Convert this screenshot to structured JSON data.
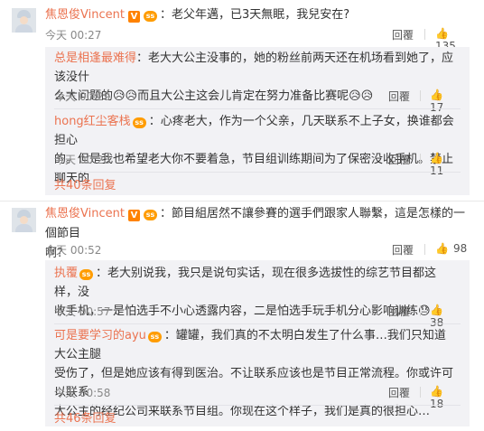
{
  "threads": [
    {
      "user": "焦恩俊Vincent",
      "v_badge": "V",
      "level_badge": "ss",
      "text": "：老父年邁，已3天無眠，我兒安在?",
      "time": "今天 00:27",
      "reply_label": "回覆",
      "likes": "135",
      "replies": [
        {
          "user": "总是相逢最难得",
          "lines": [
            "：老大大公主没事的，她的粉丝前两天还在机场看到她了，应该没什",
            "么大问题的😥😥而且大公主这会儿肯定在努力准备比赛呢😥😥"
          ],
          "time": "今天 00:29",
          "reply_label": "回覆",
          "likes": "17"
        },
        {
          "user": "hong红尘客栈",
          "level_badge": "ss",
          "lines": [
            "：心疼老大，作为一个父亲，几天联系不上子女，换谁都会担心",
            "的。但是我也希望老大你不要着急，节目组训练期间为了保密没收手机。禁止聊天的"
          ],
          "time": "今天 00:28",
          "reply_label": "回覆",
          "likes": "11"
        }
      ],
      "more": "共40条回复"
    },
    {
      "user": "焦恩俊Vincent",
      "v_badge": "V",
      "level_badge": "ss",
      "text_lines": [
        "：節目組居然不讓參賽的選手們跟家人聯繫，這是怎樣的一個節目",
        "啊?"
      ],
      "time": "今天 00:52",
      "reply_label": "回覆",
      "likes": "98",
      "replies": [
        {
          "user": "执覆",
          "level_badge": "ss",
          "lines": [
            "：老大别说我，我只是说句实话，现在很多选拔性的综艺节目都这样，没",
            "收手机，一是怕选手不小心透露内容，二是怕选手玩手机分心影响训练😓"
          ],
          "time": "今天 00:57",
          "reply_label": "回覆",
          "likes": "38"
        },
        {
          "user": "可是要学习的ayu",
          "level_badge": "ss",
          "lines": [
            "：罐罐，我们真的不太明白发生了什么事…我们只知道大公主腿",
            "受伤了，但是她应该有得到医治。不让联系应该也是节目正常流程。你或许可以联系",
            "大公主的经纪公司来联系节目组。你现在这个样子，我们是真的很担心…"
          ],
          "time": "今天 00:58",
          "reply_label": "回覆",
          "likes": "18"
        }
      ],
      "more": "共46条回复"
    }
  ],
  "colors": {
    "username": "#eb7350",
    "sub_bg": "#f2f2f5",
    "meta": "#888888"
  },
  "icons": [
    "like-icon",
    "v-badge",
    "level-badge",
    "avatar"
  ]
}
